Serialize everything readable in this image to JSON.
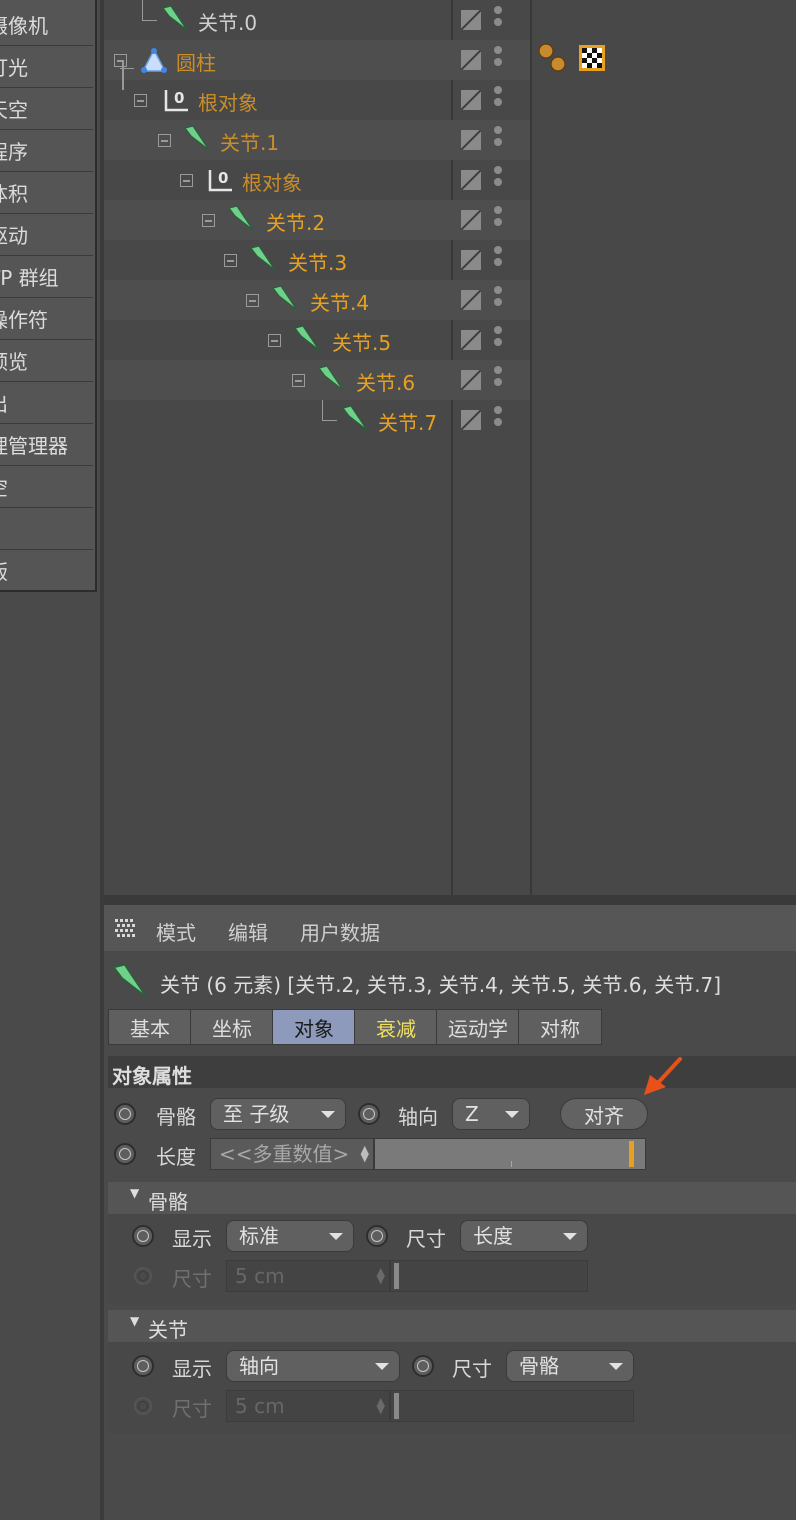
{
  "command_menu": {
    "items": [
      "摄像机",
      "灯光",
      "天空",
      "程序",
      "体积",
      "驱动",
      "TP 群组",
      "操作符",
      "预览",
      "出",
      "理管理器",
      "空",
      "",
      "版"
    ]
  },
  "tree": {
    "rows": [
      {
        "label": "关节.0",
        "style": "normal",
        "icon": "joint-icon"
      },
      {
        "label": "圆柱",
        "style": "dim-orange",
        "icon": "cylinder-icon"
      },
      {
        "label": "根对象",
        "style": "dim-orange",
        "icon": "null-object-icon"
      },
      {
        "label": "关节.1",
        "style": "dim-orange",
        "icon": "joint-icon"
      },
      {
        "label": "根对象",
        "style": "dim-orange",
        "icon": "null-object-icon"
      },
      {
        "label": "关节.2",
        "style": "orange",
        "icon": "joint-icon"
      },
      {
        "label": "关节.3",
        "style": "orange",
        "icon": "joint-icon"
      },
      {
        "label": "关节.4",
        "style": "orange",
        "icon": "joint-icon"
      },
      {
        "label": "关节.5",
        "style": "orange",
        "icon": "joint-icon"
      },
      {
        "label": "关节.6",
        "style": "orange",
        "icon": "joint-icon"
      },
      {
        "label": "关节.7",
        "style": "orange",
        "icon": "joint-icon"
      }
    ],
    "null_badge": "0"
  },
  "attributes": {
    "menubar": {
      "mode": "模式",
      "edit": "编辑",
      "user_data": "用户数据"
    },
    "header_title": "关节 (6 元素) [关节.2, 关节.3, 关节.4, 关节.5, 关节.6, 关节.7]",
    "tabs": [
      {
        "label": "基本",
        "state": "normal"
      },
      {
        "label": "坐标",
        "state": "normal"
      },
      {
        "label": "对象",
        "state": "active"
      },
      {
        "label": "衰减",
        "state": "highlight"
      },
      {
        "label": "运动学",
        "state": "normal"
      },
      {
        "label": "对称",
        "state": "normal"
      }
    ],
    "object_properties": {
      "title": "对象属性",
      "bone_label": "骨骼",
      "bone_value": "至 子级",
      "axis_label": "轴向",
      "axis_value": "Z",
      "align_button": "对齐",
      "length_label": "长度",
      "length_value": "<<多重数值>"
    },
    "bone_group": {
      "title": "骨骼",
      "display_label": "显示",
      "display_value": "标准",
      "size_label": "尺寸",
      "size_value": "长度",
      "size2_label": "尺寸",
      "size2_value": "5 cm"
    },
    "joint_group": {
      "title": "关节",
      "display_label": "显示",
      "display_value": "轴向",
      "size_label": "尺寸",
      "size_value": "骨骼",
      "size2_label": "尺寸",
      "size2_value": "5 cm"
    }
  },
  "colors": {
    "accent_orange": "#e8a020",
    "tab_active": "#8d9abb",
    "arrow": "#e8521a"
  }
}
